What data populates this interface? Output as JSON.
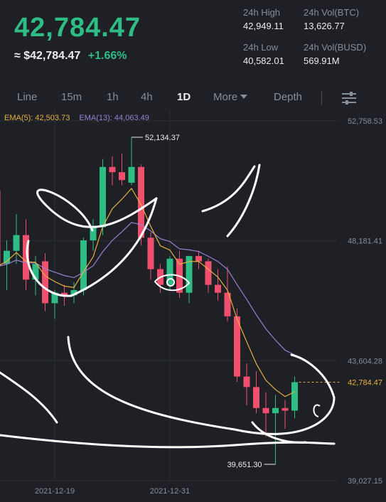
{
  "header": {
    "last_price": "42,784.47",
    "fiat_price": "≈ $42,784.47",
    "change": "+1.66%",
    "stats": {
      "high_label": "24h High",
      "high_value": "42,949.11",
      "low_label": "24h Low",
      "low_value": "40,582.01",
      "vol_btc_label": "24h Vol(BTC)",
      "vol_btc_value": "13,626.77",
      "vol_busd_label": "24h Vol(BUSD)",
      "vol_busd_value": "569.91M"
    }
  },
  "tabs": {
    "line": "Line",
    "m15": "15m",
    "h1": "1h",
    "h4": "4h",
    "d1": "1D",
    "more": "More",
    "depth": "Depth"
  },
  "colors": {
    "up": "#2ebd85",
    "down": "#f0506e",
    "ema5": "#e8b13f",
    "ema13": "#9b7fd1",
    "background": "#1e2026"
  },
  "chart_data": {
    "type": "candlestick",
    "interval": "1D",
    "ema5_label": "EMA(5): 42,503.73",
    "ema13_label": "EMA(13): 44,063.49",
    "y_ticks": [
      "52,758.53",
      "48,181.41",
      "43,604.28",
      "39,027.15"
    ],
    "y_tick_values": [
      52758.53,
      48181.41,
      43604.28,
      39027.15
    ],
    "ylim": [
      39027.15,
      52758.53
    ],
    "x_tick_labels": [
      {
        "label": "2021-12-19",
        "index": 6
      },
      {
        "label": "2021-12-31",
        "index": 18
      }
    ],
    "current_price_label": "42,784.47",
    "current_price": 42784.47,
    "high_annotation": {
      "label": "52,134.37",
      "value": 52134.37,
      "index": 14
    },
    "low_annotation": {
      "label": "39,651.30",
      "value": 39651.3,
      "index": 29
    },
    "candles": [
      {
        "o": 50100,
        "h": 50600,
        "l": 46800,
        "c": 47200
      },
      {
        "o": 47300,
        "h": 48200,
        "l": 46300,
        "c": 47800
      },
      {
        "o": 47800,
        "h": 49200,
        "l": 47300,
        "c": 48400
      },
      {
        "o": 48400,
        "h": 49000,
        "l": 46300,
        "c": 46700
      },
      {
        "o": 46700,
        "h": 47600,
        "l": 46100,
        "c": 47300
      },
      {
        "o": 47400,
        "h": 47700,
        "l": 45500,
        "c": 45800
      },
      {
        "o": 45800,
        "h": 46300,
        "l": 45200,
        "c": 46200
      },
      {
        "o": 46200,
        "h": 46500,
        "l": 45700,
        "c": 46100
      },
      {
        "o": 46100,
        "h": 46600,
        "l": 45800,
        "c": 46300
      },
      {
        "o": 46300,
        "h": 48300,
        "l": 46100,
        "c": 48200
      },
      {
        "o": 48200,
        "h": 49000,
        "l": 47800,
        "c": 48700
      },
      {
        "o": 48700,
        "h": 51300,
        "l": 48400,
        "c": 51000
      },
      {
        "o": 51000,
        "h": 51400,
        "l": 50300,
        "c": 50800
      },
      {
        "o": 50800,
        "h": 51500,
        "l": 50300,
        "c": 50500
      },
      {
        "o": 50400,
        "h": 52134.37,
        "l": 50300,
        "c": 51000
      },
      {
        "o": 51000,
        "h": 51100,
        "l": 48000,
        "c": 48300
      },
      {
        "o": 48300,
        "h": 48500,
        "l": 46700,
        "c": 47100
      },
      {
        "o": 47100,
        "h": 47300,
        "l": 46200,
        "c": 46500
      },
      {
        "o": 46500,
        "h": 47600,
        "l": 46300,
        "c": 47500
      },
      {
        "o": 47500,
        "h": 47800,
        "l": 46000,
        "c": 46200
      },
      {
        "o": 46200,
        "h": 47600,
        "l": 45800,
        "c": 47600
      },
      {
        "o": 47600,
        "h": 47800,
        "l": 47100,
        "c": 47400
      },
      {
        "o": 47400,
        "h": 47500,
        "l": 46200,
        "c": 46500
      },
      {
        "o": 46500,
        "h": 47100,
        "l": 45900,
        "c": 46200
      },
      {
        "o": 46200,
        "h": 47200,
        "l": 45100,
        "c": 45300
      },
      {
        "o": 45300,
        "h": 45600,
        "l": 42800,
        "c": 43000
      },
      {
        "o": 43000,
        "h": 43500,
        "l": 41900,
        "c": 42600
      },
      {
        "o": 42600,
        "h": 43200,
        "l": 41600,
        "c": 41800
      },
      {
        "o": 41800,
        "h": 42400,
        "l": 40700,
        "c": 41600
      },
      {
        "o": 41600,
        "h": 42300,
        "l": 39651.3,
        "c": 41800
      },
      {
        "o": 41800,
        "h": 42100,
        "l": 41000,
        "c": 41700
      },
      {
        "o": 41700,
        "h": 43000,
        "l": 41400,
        "c": 42784.47
      }
    ]
  }
}
